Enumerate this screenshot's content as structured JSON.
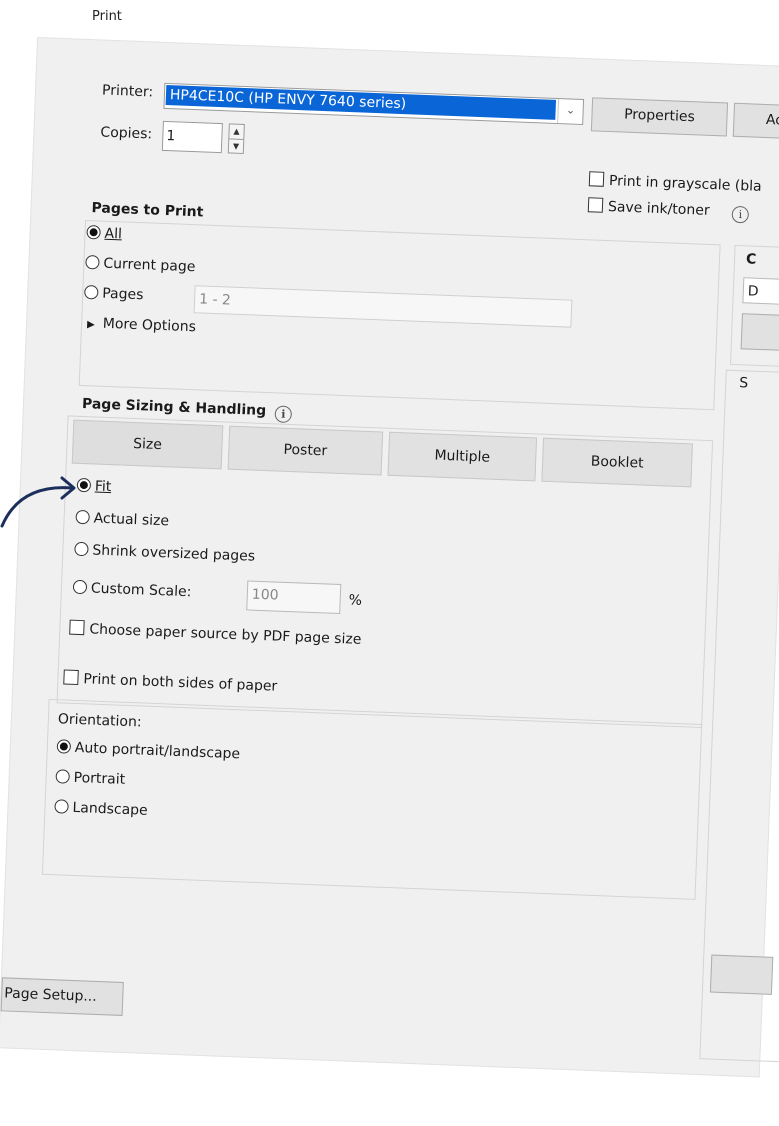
{
  "window": {
    "title": "Print"
  },
  "printer": {
    "label": "Printer:",
    "value": "HP4CE10C (HP ENVY 7640 series)",
    "properties_label": "Properties",
    "advanced_label_partial": "Ac",
    "grayscale_label": "Print in grayscale (bla",
    "save_ink_label": "Save ink/toner"
  },
  "copies": {
    "label": "Copies:",
    "value": "1"
  },
  "pages_to_print": {
    "title": "Pages to Print",
    "all_label": "All",
    "current_label": "Current page",
    "pages_label": "Pages",
    "pages_value": "1 - 2",
    "more_options_label": "More Options"
  },
  "page_sizing": {
    "title": "Page Sizing & Handling",
    "tabs": [
      "Size",
      "Poster",
      "Multiple",
      "Booklet"
    ],
    "fit_label": "Fit",
    "actual_label": "Actual size",
    "shrink_label": "Shrink oversized pages",
    "custom_label": "Custom Scale:",
    "custom_value": "100",
    "percent": "%",
    "paper_source_label": "Choose paper source by PDF page size"
  },
  "duplex": {
    "label": "Print on both sides of paper"
  },
  "orientation": {
    "title": "Orientation:",
    "auto_label": "Auto portrait/landscape",
    "portrait_label": "Portrait",
    "landscape_label": "Landscape"
  },
  "right_panel": {
    "comments_partial": "C",
    "dropdown_partial": "D",
    "summary_partial": "S"
  },
  "footer": {
    "page_setup_label": "Page Setup..."
  },
  "colors": {
    "selection": "#0a66d6",
    "arrow": "#1c2f5c",
    "dialog_bg": "#f0f0f0"
  },
  "icons": {
    "annotation": "curved-arrow-icon",
    "info": "info-icon"
  }
}
